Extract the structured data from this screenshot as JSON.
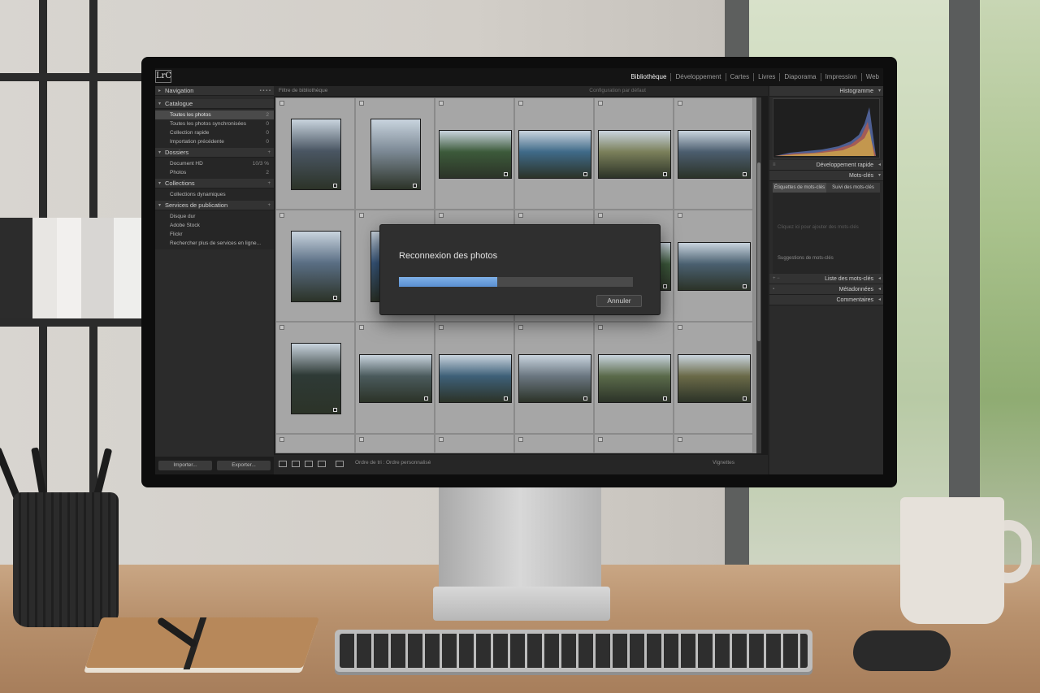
{
  "app": {
    "logo": "LrC",
    "modules": [
      "Bibliothèque",
      "Développement",
      "Cartes",
      "Livres",
      "Diaporama",
      "Impression",
      "Web"
    ],
    "active_module": "Bibliothèque"
  },
  "left_panel": {
    "navigation": "Navigation",
    "catalogue": {
      "title": "Catalogue",
      "items": [
        {
          "label": "Toutes les photos",
          "count": "2"
        },
        {
          "label": "Toutes les photos synchronisées",
          "count": "0"
        },
        {
          "label": "Collection rapide",
          "count": "0"
        },
        {
          "label": "Importation précédente",
          "count": "0"
        }
      ]
    },
    "dossiers": {
      "title": "Dossiers",
      "items": [
        {
          "label": "Document HD",
          "count": "10/3 %"
        },
        {
          "label": "Photos",
          "count": "2"
        }
      ]
    },
    "collections": {
      "title": "Collections",
      "items": [
        {
          "label": "Collections dynamiques"
        }
      ]
    },
    "publication": {
      "title": "Services de publication",
      "items": [
        {
          "label": "Disque dur"
        },
        {
          "label": "Adobe Stock"
        },
        {
          "label": "Flickr"
        },
        {
          "label": "Rechercher plus de services en ligne..."
        }
      ]
    },
    "import_button": "Importer...",
    "export_button": "Exporter..."
  },
  "center": {
    "filter_bar": "Filtre de bibliothèque",
    "filter_preset": "Configuration par défaut",
    "toolbar": {
      "sort_label": "Ordre de tri :",
      "sort_value": "Ordre personnalisé",
      "thumbnails_label": "Vignettes"
    },
    "thumbnail_colors": [
      [
        "#4a5663",
        "#7d8a96",
        "#3c5a3a",
        "#3f6a88",
        "#7a7f5a",
        "#4b5d6e"
      ],
      [
        "#5a6e84",
        "#3a5a80",
        "#5d7a8a",
        "#4d6a7c",
        "#3d5a3c",
        "#4a6070"
      ],
      [
        "#2e3a36",
        "#4a5a5c",
        "#3e6078",
        "#6a7680",
        "#5a6a4a",
        "#6a6a48"
      ]
    ]
  },
  "right_panel": {
    "histogram": "Histogramme",
    "quick_develop": "Développement rapide",
    "keywords": "Mots-clés",
    "keyword_tabs": [
      "Étiquettes de mots-clés",
      "Suivi des mots-clés"
    ],
    "keyword_hint_a": "Cliquez ici pour ajouter des mots-clés",
    "keyword_hint_b": "Suggestions de mots-clés",
    "keyword_list": "Liste des mots-clés",
    "metadata": "Métadonnées",
    "comments": "Commentaires"
  },
  "dialog": {
    "title": "Reconnexion des photos",
    "progress": 0.42,
    "cancel": "Annuler"
  },
  "colors": {
    "accent": "#6a9fdc",
    "panel": "#2b2b2b",
    "grid": "#a6a6a6"
  }
}
